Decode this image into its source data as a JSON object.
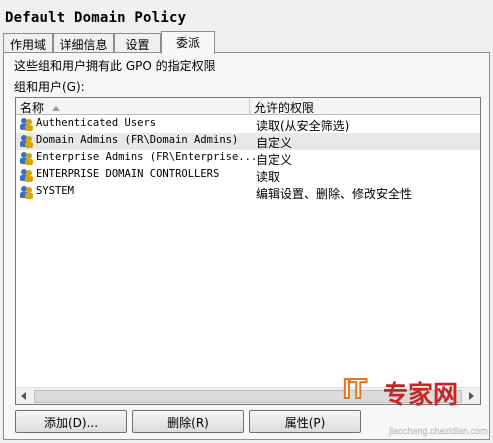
{
  "window": {
    "title": "Default Domain Policy"
  },
  "tabs": [
    {
      "label": "作用域"
    },
    {
      "label": "详细信息"
    },
    {
      "label": "设置"
    },
    {
      "label": "委派"
    }
  ],
  "active_tab": "委派",
  "panel": {
    "description": "这些组和用户拥有此 GPO 的指定权限",
    "group_label": "组和用户(G):"
  },
  "list": {
    "columns": [
      {
        "label": "名称",
        "sort": "ascending"
      },
      {
        "label": "允许的权限"
      }
    ],
    "rows": [
      {
        "name": "Authenticated Users",
        "permission": "读取(从安全筛选)",
        "icon": "group-users-icon"
      },
      {
        "name": "Domain Admins (FR\\Domain Admins)",
        "permission": "自定义",
        "icon": "group-users-icon",
        "selected": true
      },
      {
        "name": "Enterprise Admins (FR\\Enterprise...",
        "permission": "自定义",
        "icon": "group-users-icon"
      },
      {
        "name": "ENTERPRISE DOMAIN CONTROLLERS",
        "permission": "读取",
        "icon": "group-users-icon"
      },
      {
        "name": "SYSTEM",
        "permission": "编辑设置、删除、修改安全性",
        "icon": "group-users-icon"
      }
    ]
  },
  "buttons": {
    "add": "添加(D)...",
    "remove": "删除(R)",
    "properties": "属性(P)"
  },
  "watermark": {
    "it": "IT",
    "brand": "专家网",
    "url": "jiaocheng.chazidian.com"
  },
  "colors": {
    "selected_row": "#e8e8e8",
    "icon_user_a": "#3a6fc4",
    "icon_user_b": "#d9a400",
    "watermark_orange": "#e07a1c",
    "watermark_red": "#c62626"
  }
}
